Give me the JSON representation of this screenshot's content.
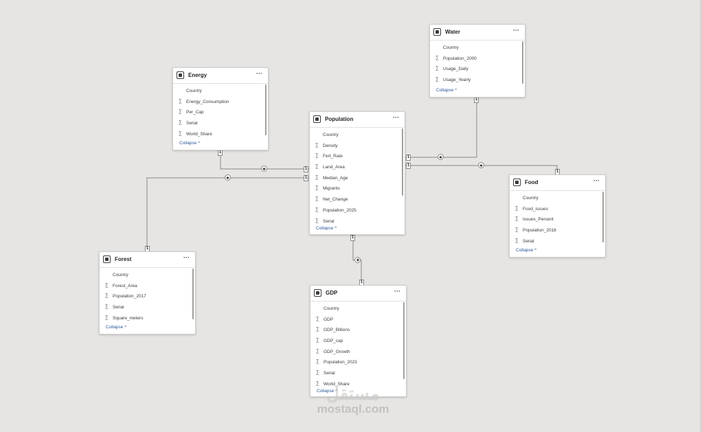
{
  "tables": {
    "energy": {
      "title": "Energy",
      "fields": [
        {
          "name": "Country",
          "sigma": ""
        },
        {
          "name": "Energy_Consumption",
          "sigma": "∑"
        },
        {
          "name": "Per_Cap",
          "sigma": "∑"
        },
        {
          "name": "Serial",
          "sigma": "∑"
        },
        {
          "name": "World_Share",
          "sigma": "∑"
        }
      ],
      "collapse": "Collapse ^"
    },
    "water": {
      "title": "Water",
      "fields": [
        {
          "name": "Country",
          "sigma": ""
        },
        {
          "name": "Population_2000",
          "sigma": "∑"
        },
        {
          "name": "Usage_Daily",
          "sigma": "∑"
        },
        {
          "name": "Usage_Yearly",
          "sigma": "∑"
        }
      ],
      "collapse": "Collapse ^"
    },
    "population": {
      "title": "Population",
      "fields": [
        {
          "name": "Country",
          "sigma": ""
        },
        {
          "name": "Density",
          "sigma": "∑"
        },
        {
          "name": "Fert_Rate",
          "sigma": "∑"
        },
        {
          "name": "Land_Area",
          "sigma": "∑"
        },
        {
          "name": "Median_Age",
          "sigma": "∑"
        },
        {
          "name": "Migrants",
          "sigma": "∑"
        },
        {
          "name": "Net_Change",
          "sigma": "∑"
        },
        {
          "name": "Population_2025",
          "sigma": "∑"
        },
        {
          "name": "Serial",
          "sigma": "∑"
        }
      ],
      "collapse": "Collapse ^"
    },
    "food": {
      "title": "Food",
      "fields": [
        {
          "name": "Country",
          "sigma": ""
        },
        {
          "name": "Food_issues",
          "sigma": "∑"
        },
        {
          "name": "Issues_Percent",
          "sigma": "∑"
        },
        {
          "name": "Population_2018",
          "sigma": "∑"
        },
        {
          "name": "Serial",
          "sigma": "∑"
        }
      ],
      "collapse": "Collapse ^"
    },
    "forest": {
      "title": "Forest",
      "fields": [
        {
          "name": "Country",
          "sigma": ""
        },
        {
          "name": "Forest_Area",
          "sigma": "∑"
        },
        {
          "name": "Population_2017",
          "sigma": "∑"
        },
        {
          "name": "Serial",
          "sigma": "∑"
        },
        {
          "name": "Square_meters",
          "sigma": "∑"
        }
      ],
      "collapse": "Collapse ^"
    },
    "gdp": {
      "title": "GDP",
      "fields": [
        {
          "name": "Country",
          "sigma": ""
        },
        {
          "name": "GDP",
          "sigma": "∑"
        },
        {
          "name": "GDP_Billions",
          "sigma": "∑"
        },
        {
          "name": "GDP_cap",
          "sigma": "∑"
        },
        {
          "name": "GDP_Growth",
          "sigma": "∑"
        },
        {
          "name": "Population_2023",
          "sigma": "∑"
        },
        {
          "name": "Serial",
          "sigma": "∑"
        },
        {
          "name": "World_Share",
          "sigma": "∑"
        }
      ],
      "collapse": "Collapse ^"
    }
  },
  "more_label": "···",
  "cardinality_one": "1",
  "watermark": {
    "logo": "مستقل",
    "text": "mostaql.com"
  },
  "colors": {
    "canvas": "#e6e5e3",
    "line": "#8a8886",
    "link": "#2b579a"
  }
}
